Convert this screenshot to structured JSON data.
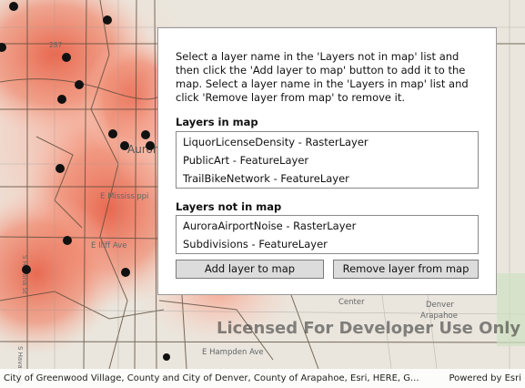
{
  "instructions": "Select a layer name in the 'Layers not in map' list and then click the 'Add layer to map' button to add it to the map. Select a layer name in the 'Layers in map' list and click 'Remove layer from map' to remove it.",
  "layers_in_map": {
    "label": "Layers in map",
    "items": [
      "LiquorLicenseDensity - RasterLayer",
      "PublicArt - FeatureLayer",
      "TrailBikeNetwork - FeatureLayer"
    ]
  },
  "layers_not_in_map": {
    "label": "Layers not in map",
    "items": [
      "AuroraAirportNoise - RasterLayer",
      "Subdivisions - FeatureLayer"
    ]
  },
  "buttons": {
    "add": "Add layer to map",
    "remove": "Remove layer from map"
  },
  "map": {
    "watermark": "Licensed For Developer Use Only",
    "attribution": "City of Greenwood Village, County and City of Denver, County of Arapahoe, Esri, HERE, G...",
    "powered_by": "Powered by Esri",
    "labels": [
      "287",
      "E Mississippi",
      "E Iliff Ave",
      "E Hampden Ave",
      "Center",
      "Denver",
      "Arapahoe",
      "Aurora",
      "S Havana St",
      "S Havana St"
    ]
  }
}
